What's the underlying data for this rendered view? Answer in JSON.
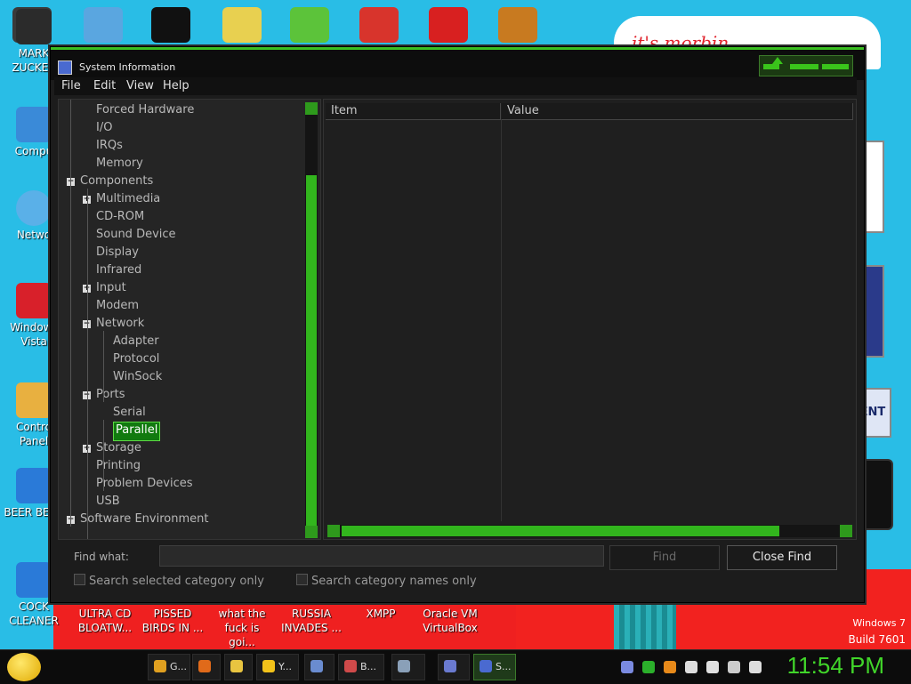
{
  "desktop": {
    "icons_left": [
      {
        "label": "MARK ZUCKER"
      },
      {
        "label": "Compu"
      },
      {
        "label": "Netwo"
      },
      {
        "label": "Windows Vista"
      },
      {
        "label": "Contro Panel"
      },
      {
        "label": "BEER BEER"
      },
      {
        "label": "COCK CLEANER"
      }
    ],
    "icons_bottom": [
      {
        "label": "ULTRA CD BLOATW..."
      },
      {
        "label": "PISSED BIRDS IN ..."
      },
      {
        "label": "what the fuck is goi..."
      },
      {
        "label": "RUSSIA INVADES ..."
      },
      {
        "label": "XMPP"
      },
      {
        "label": "Oracle VM VirtualBox"
      }
    ],
    "top_icons": [
      {
        "name": "user-folder-icon",
        "color": "#3a3a3a"
      },
      {
        "name": "notepad-icon",
        "color": "#5aa6e0"
      },
      {
        "name": "cmd-icon",
        "color": "#111111"
      },
      {
        "name": "ftp-icon",
        "color": "#e8d050"
      },
      {
        "name": "angry-birds-icon",
        "color": "#5cc33a"
      },
      {
        "name": "p-app-icon",
        "color": "#d8342c"
      },
      {
        "name": "devcpp-icon",
        "color": "#d82020"
      },
      {
        "name": "terminal-icon",
        "color": "#c87a20"
      }
    ],
    "wallpaper_text": "it's morbin",
    "wallpaper_card_text": "ENT",
    "watermark": {
      "line1": "Windows 7",
      "line2": "Build 7601"
    }
  },
  "window": {
    "title": "System Information",
    "menu": [
      "File",
      "Edit",
      "View",
      "Help"
    ],
    "tree": [
      {
        "label": "Forced Hardware",
        "depth": 1,
        "expander": ""
      },
      {
        "label": "I/O",
        "depth": 1,
        "expander": ""
      },
      {
        "label": "IRQs",
        "depth": 1,
        "expander": ""
      },
      {
        "label": "Memory",
        "depth": 1,
        "expander": ""
      },
      {
        "label": "Components",
        "depth": 0,
        "expander": "−"
      },
      {
        "label": "Multimedia",
        "depth": 1,
        "expander": "+"
      },
      {
        "label": "CD-ROM",
        "depth": 1,
        "expander": ""
      },
      {
        "label": "Sound Device",
        "depth": 1,
        "expander": ""
      },
      {
        "label": "Display",
        "depth": 1,
        "expander": ""
      },
      {
        "label": "Infrared",
        "depth": 1,
        "expander": ""
      },
      {
        "label": "Input",
        "depth": 1,
        "expander": "+"
      },
      {
        "label": "Modem",
        "depth": 1,
        "expander": ""
      },
      {
        "label": "Network",
        "depth": 1,
        "expander": "−"
      },
      {
        "label": "Adapter",
        "depth": 2,
        "expander": ""
      },
      {
        "label": "Protocol",
        "depth": 2,
        "expander": ""
      },
      {
        "label": "WinSock",
        "depth": 2,
        "expander": ""
      },
      {
        "label": "Ports",
        "depth": 1,
        "expander": "−"
      },
      {
        "label": "Serial",
        "depth": 2,
        "expander": ""
      },
      {
        "label": "Parallel",
        "depth": 2,
        "expander": "",
        "selected": true
      },
      {
        "label": "Storage",
        "depth": 1,
        "expander": "+"
      },
      {
        "label": "Printing",
        "depth": 1,
        "expander": ""
      },
      {
        "label": "Problem Devices",
        "depth": 1,
        "expander": ""
      },
      {
        "label": "USB",
        "depth": 1,
        "expander": ""
      },
      {
        "label": "Software Environment",
        "depth": 0,
        "expander": "+"
      }
    ],
    "columns": [
      "Item",
      "Value"
    ],
    "find_label": "Find what:",
    "find_value": "",
    "find_button": "Find",
    "close_find_button": "Close Find",
    "check_selected_category": "Search selected category only",
    "check_category_names": "Search category names only"
  },
  "taskbar": {
    "buttons": [
      {
        "label": "G...",
        "icon": "chrome-icon",
        "color": "#e0a020"
      },
      {
        "label": "",
        "icon": "firefox-icon",
        "color": "#e06a1a"
      },
      {
        "label": "",
        "icon": "explorer-folder-icon",
        "color": "#e8c440"
      },
      {
        "label": "Y...",
        "icon": "yahoo-smiley-icon",
        "color": "#f2c21a"
      },
      {
        "label": "",
        "icon": "virtualbox-icon",
        "color": "#6a8cd0"
      },
      {
        "label": "B...",
        "icon": "installer-icon",
        "color": "#d04a4a"
      },
      {
        "label": "",
        "icon": "computer-icon",
        "color": "#8aa0b8"
      },
      {
        "label": "",
        "icon": "generic-app-icon",
        "color": "#6a7ad0"
      },
      {
        "label": "S...",
        "icon": "system-info-icon",
        "color": "#4a6ad0",
        "active": true
      }
    ],
    "tray": [
      {
        "icon": "app-tray-icon",
        "color": "#7a8ae0"
      },
      {
        "icon": "green-app-tray-icon",
        "color": "#2bb02b"
      },
      {
        "icon": "search-tray-icon",
        "color": "#e88a1a"
      },
      {
        "icon": "messenger-tray-icon",
        "color": "#dddddd"
      },
      {
        "icon": "flag-tray-icon",
        "color": "#e0e0e0"
      },
      {
        "icon": "network-tray-icon",
        "color": "#cccccc"
      },
      {
        "icon": "volume-tray-icon",
        "color": "#dddddd"
      }
    ],
    "clock": "11:54 PM"
  }
}
